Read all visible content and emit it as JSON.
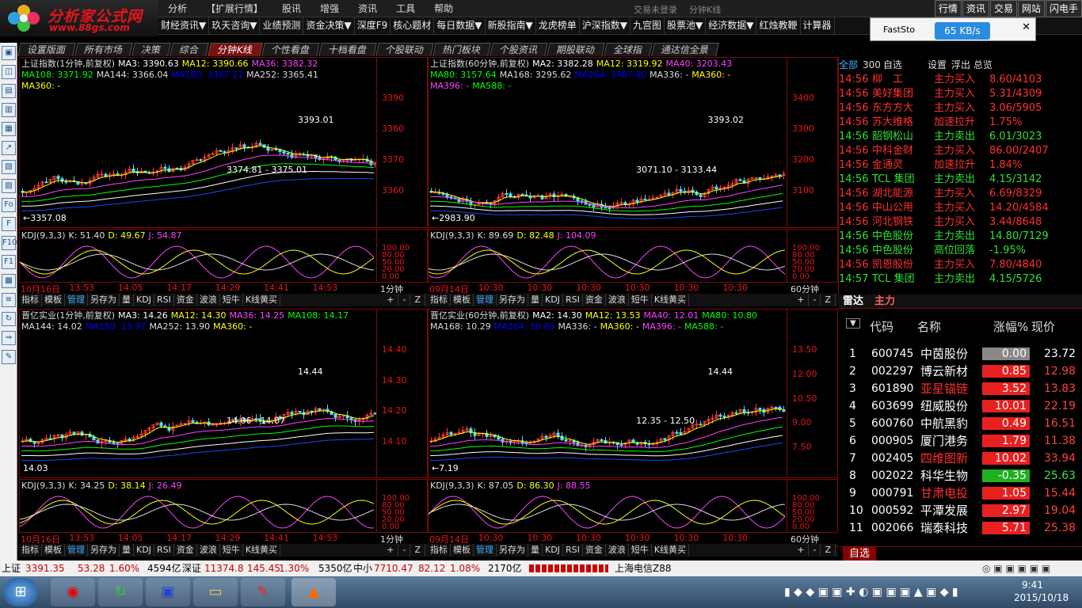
{
  "app": {
    "logo_text": "分析家公式网",
    "logo_url": "www.88gs.com",
    "title_status": "交易未登录",
    "title_mode": "分钟K线",
    "watermark": "www.55188.com"
  },
  "menu": [
    "分析",
    "【扩展行情】",
    "股讯",
    "增强",
    "资讯",
    "工具",
    "帮助"
  ],
  "right_buttons": [
    "行情",
    "资讯",
    "交易",
    "网站",
    "闪电手"
  ],
  "toolbar": [
    "财经资讯▼",
    "玖天咨询▼",
    "业绩预测",
    "资金决策▼",
    "深度F9",
    "核心题材",
    "每日数据▼",
    "新股指南▼",
    "龙虎榜单",
    "沪深指数▼",
    "九宫图",
    "股票池▼",
    "经济数据▼",
    "红烛教鞭",
    "计算器"
  ],
  "fs": {
    "label": "FastSto",
    "speed": "65 KB/s"
  },
  "tabs": [
    "设置版面",
    "所有市场",
    "决策",
    "综合",
    "分钟K线",
    "个性看盘",
    "十档看盘",
    "个股联动",
    "热门板块",
    "个股资讯",
    "期股联动",
    "全球指",
    "通达信全景"
  ],
  "active_tab": "分钟K线",
  "left_icons": [
    "▣",
    "◫",
    "▤",
    "▥",
    "▦",
    "↗",
    "▧",
    "▨",
    "Fo",
    "F",
    "F10",
    "F1",
    "▩",
    "≡",
    "↻",
    "⇒",
    "✎"
  ],
  "panels": {
    "p1": {
      "title": "上证指数(1分钟,前复权)",
      "ma_line1": [
        [
          "MA3: 3390.63",
          "#ffffff"
        ],
        [
          "MA12: 3390.66",
          "#ffff00"
        ],
        [
          "MA36: 3382.32",
          "#ff40ff"
        ]
      ],
      "ma_line2": [
        [
          "MA108: 3371.92",
          "#00ff00"
        ],
        [
          "MA144: 3366.04",
          "#dddddd"
        ],
        [
          "MA180: 3367.11",
          "#0000ff"
        ],
        [
          "MA252: 3365.41",
          "#dddddd"
        ]
      ],
      "ma_line3": [
        [
          "MA360: -",
          "#ffff00"
        ]
      ],
      "annotations": [
        "3393.01",
        "3374.81 - 3375.01",
        "←3357.08"
      ],
      "axis": [
        "3390",
        "3380",
        "3370",
        "3360"
      ],
      "kdj": [
        [
          "KDJ(9,3,3)",
          "#dddddd"
        ],
        [
          "K: 51.40",
          "#dddddd"
        ],
        [
          "D: 49.67",
          "#ffff00"
        ],
        [
          "J: 54.87",
          "#ff40ff"
        ]
      ],
      "kdj_axis": [
        "100.00",
        "80.00",
        "50.00",
        "20.00",
        "0.00"
      ],
      "times": [
        "10月16日",
        "13:53",
        "14:05",
        "14:17",
        "14:29",
        "14:41",
        "14:53"
      ],
      "period": "1分钟"
    },
    "p2": {
      "title": "上证指数(60分钟,前复权)",
      "ma_line1": [
        [
          "MA2: 3382.28",
          "#ffffff"
        ],
        [
          "MA12: 3319.92",
          "#ffff00"
        ],
        [
          "MA40: 3203.43",
          "#ff40ff"
        ]
      ],
      "ma_line2": [
        [
          "MA80: 3157.64",
          "#00ff00"
        ],
        [
          "MA168: 3295.62",
          "#dddddd"
        ],
        [
          "MA264: 3487.40",
          "#0000ff"
        ],
        [
          "MA336: -",
          "#dddddd"
        ],
        [
          "MA360: -",
          "#ffff00"
        ]
      ],
      "ma_line3": [
        [
          "MA396: -",
          "#ff40ff"
        ],
        [
          "MA588: -",
          "#00ff00"
        ]
      ],
      "annotations": [
        "3393.02",
        "3071.10 - 3133.44",
        "←2983.90"
      ],
      "axis": [
        "3400",
        "3300",
        "3200",
        "3100"
      ],
      "kdj": [
        [
          "KDJ(9,3,3)",
          "#dddddd"
        ],
        [
          "K: 89.69",
          "#dddddd"
        ],
        [
          "D: 82.48",
          "#ffff00"
        ],
        [
          "J: 104.09",
          "#ff40ff"
        ]
      ],
      "kdj_axis": [
        "100.00",
        "80.00",
        "50.00",
        "20.00",
        "0.00"
      ],
      "times": [
        "09月14日",
        "10:30",
        "10:30",
        "10:30",
        "10:30",
        "10:30",
        "10:30"
      ],
      "period": "60分钟"
    },
    "p3": {
      "title": "晋亿实业(1分钟,前复权)",
      "ma_line1": [
        [
          "MA3: 14.26",
          "#ffffff"
        ],
        [
          "MA12: 14.30",
          "#ffff00"
        ],
        [
          "MA36: 14.25",
          "#ff40ff"
        ],
        [
          "MA108: 14.17",
          "#00ff00"
        ]
      ],
      "ma_line2": [
        [
          "MA144: 14.02",
          "#dddddd"
        ],
        [
          "MA180: 13.97",
          "#0000ff"
        ],
        [
          "MA252: 13.90",
          "#dddddd"
        ],
        [
          "MA360: -",
          "#ffff00"
        ]
      ],
      "ma_line3": [],
      "annotations": [
        "14.44",
        "14.06 - 14.07",
        "14.03"
      ],
      "axis": [
        "14.40",
        "14.30",
        "14.20",
        "14.10"
      ],
      "kdj": [
        [
          "KDJ(9,3,3)",
          "#dddddd"
        ],
        [
          "K: 34.25",
          "#dddddd"
        ],
        [
          "D: 38.14",
          "#ffff00"
        ],
        [
          "J: 26.49",
          "#ff40ff"
        ]
      ],
      "kdj_axis": [
        "100.00",
        "80.00",
        "50.00",
        "20.00",
        "0.00"
      ],
      "times": [
        "10月16日",
        "13:53",
        "14:05",
        "14:17",
        "14:29",
        "14:41",
        "14:53"
      ],
      "period": "1分钟"
    },
    "p4": {
      "title": "晋亿实业(60分钟,前复权)",
      "ma_line1": [
        [
          "MA2: 14.30",
          "#ffffff"
        ],
        [
          "MA12: 13.53",
          "#ffff00"
        ],
        [
          "MA40: 12.01",
          "#ff40ff"
        ],
        [
          "MA80: 10.80",
          "#00ff00"
        ]
      ],
      "ma_line2": [
        [
          "MA168: 10.29",
          "#dddddd"
        ],
        [
          "MA264: 10.63",
          "#0000ff"
        ],
        [
          "MA336: -",
          "#dddddd"
        ],
        [
          "MA360: -",
          "#ffff00"
        ],
        [
          "MA396: -",
          "#ff40ff"
        ],
        [
          "MA588: -",
          "#00ff00"
        ]
      ],
      "ma_line3": [],
      "annotations": [
        "14.44",
        "12.35 - 12.50",
        "←7.19"
      ],
      "axis": [
        "13.50",
        "12.00",
        "10.50",
        "9.00",
        "7.50"
      ],
      "kdj": [
        [
          "KDJ(9,3,3)",
          "#dddddd"
        ],
        [
          "K: 87.05",
          "#dddddd"
        ],
        [
          "D: 86.30",
          "#ffff00"
        ],
        [
          "J: 88.55",
          "#ff40ff"
        ]
      ],
      "kdj_axis": [
        "100.00",
        "80.00",
        "50.00",
        "20.00",
        "0.00"
      ],
      "times": [
        "09月14日",
        "10:30",
        "10:30",
        "10:30",
        "10:30",
        "10:30",
        "10:30"
      ],
      "period": "60分钟"
    }
  },
  "panel_buttons": [
    "指标",
    "模板",
    "管理",
    "另存为",
    "量",
    "KDJ",
    "RSI",
    "资金",
    "波浪",
    "短牛",
    "K线黄买"
  ],
  "panel_ctrl": [
    "+",
    "-",
    "Z"
  ],
  "ticker_head": [
    "全部",
    "300",
    "自选",
    "设置",
    "浮出",
    "总览"
  ],
  "ticker": [
    [
      "14:56",
      "柳　工",
      "主力买入",
      "8.60/4103",
      "#ff3030"
    ],
    [
      "14:56",
      "美好集团",
      "主力买入",
      "5.31/4309",
      "#ff3030"
    ],
    [
      "14:56",
      "东方方大",
      "主力买入",
      "3.06/5905",
      "#ff3030"
    ],
    [
      "14:56",
      "苏大维格",
      "加速拉升",
      "1.75%",
      "#ff3030"
    ],
    [
      "14:56",
      "韶钢松山",
      "主力卖出",
      "6.01/3023",
      "#30e030"
    ],
    [
      "14:56",
      "中科金财",
      "主力买入",
      "86.00/2407",
      "#ff3030"
    ],
    [
      "14:56",
      "金通灵",
      "加速拉升",
      "1.84%",
      "#ff3030"
    ],
    [
      "14:56",
      "TCL 集团",
      "主力卖出",
      "4.15/3142",
      "#30e030"
    ],
    [
      "14:56",
      "湖北能源",
      "主力买入",
      "6.69/8329",
      "#ff3030"
    ],
    [
      "14:56",
      "中山公用",
      "主力买入",
      "14.20/4584",
      "#ff3030"
    ],
    [
      "14:56",
      "河北钢铁",
      "主力买入",
      "3.44/8648",
      "#ff3030"
    ],
    [
      "14:56",
      "中色股份",
      "主力卖出",
      "14.80/7129",
      "#30e030"
    ],
    [
      "14:56",
      "中色股份",
      "高位回落",
      "-1.95%",
      "#30e030"
    ],
    [
      "14:56",
      "凯恩股份",
      "主力买入",
      "7.80/4840",
      "#ff3030"
    ],
    [
      "14:57",
      "TCL 集团",
      "主力卖出",
      "4.15/5726",
      "#30e030"
    ]
  ],
  "rank_tabs": [
    "雷达",
    "主力"
  ],
  "rank_cols": [
    "代码",
    "名称",
    "涨幅%",
    "现价"
  ],
  "rank": [
    [
      "1",
      "600745",
      "中茵股份",
      "",
      "0.00",
      "23.72",
      "gray",
      "#ffffff"
    ],
    [
      "2",
      "002297",
      "博云新材",
      "",
      "0.85",
      "12.98",
      "red",
      "#ffffff"
    ],
    [
      "3",
      "601890",
      "亚星锚链",
      "",
      "3.52",
      "13.83",
      "red",
      "#ff3030"
    ],
    [
      "4",
      "603699",
      "纽威股份",
      "",
      "10.01",
      "22.19",
      "red",
      "#ffffff"
    ],
    [
      "5",
      "600760",
      "中航黑豹",
      "",
      "0.49",
      "16.51",
      "red",
      "#ffffff"
    ],
    [
      "6",
      "000905",
      "厦门港务",
      "R",
      "1.79",
      "11.38",
      "red",
      "#ffffff"
    ],
    [
      "7",
      "002405",
      "四维图新",
      "R",
      "10.02",
      "33.94",
      "red",
      "#ff3030"
    ],
    [
      "8",
      "002022",
      "科华生物",
      "",
      "-0.35",
      "25.63",
      "green",
      "#ffffff"
    ],
    [
      "9",
      "000791",
      "甘肃电投",
      "*",
      "1.05",
      "15.44",
      "red",
      "#ff3030"
    ],
    [
      "10",
      "000592",
      "平潭发展",
      "R",
      "2.97",
      "19.04",
      "red",
      "#ffffff"
    ],
    [
      "11",
      "002066",
      "瑞泰科技",
      "",
      "5.71",
      "25.38",
      "red",
      "#ffffff"
    ]
  ],
  "rank_footer": "自选",
  "status": {
    "sh_label": "上证",
    "sh_val": "3391.35",
    "sh_chg": "53.28",
    "sh_pct": "1.60%",
    "sh_amt": "4594亿",
    "sz_label": "深证",
    "sz_val": "11374.8",
    "sz_chg": "145.45",
    "sz_pct": "1.30%",
    "sz_amt": "5350亿",
    "zx_label": "中小",
    "zx_val": "7710.47",
    "zx_chg": "82.12",
    "zx_pct": "1.08%",
    "zx_amt": "2170亿",
    "server": "上海电信Z88"
  },
  "taskbar": {
    "time": "9:41",
    "date": "2015/10/18"
  }
}
